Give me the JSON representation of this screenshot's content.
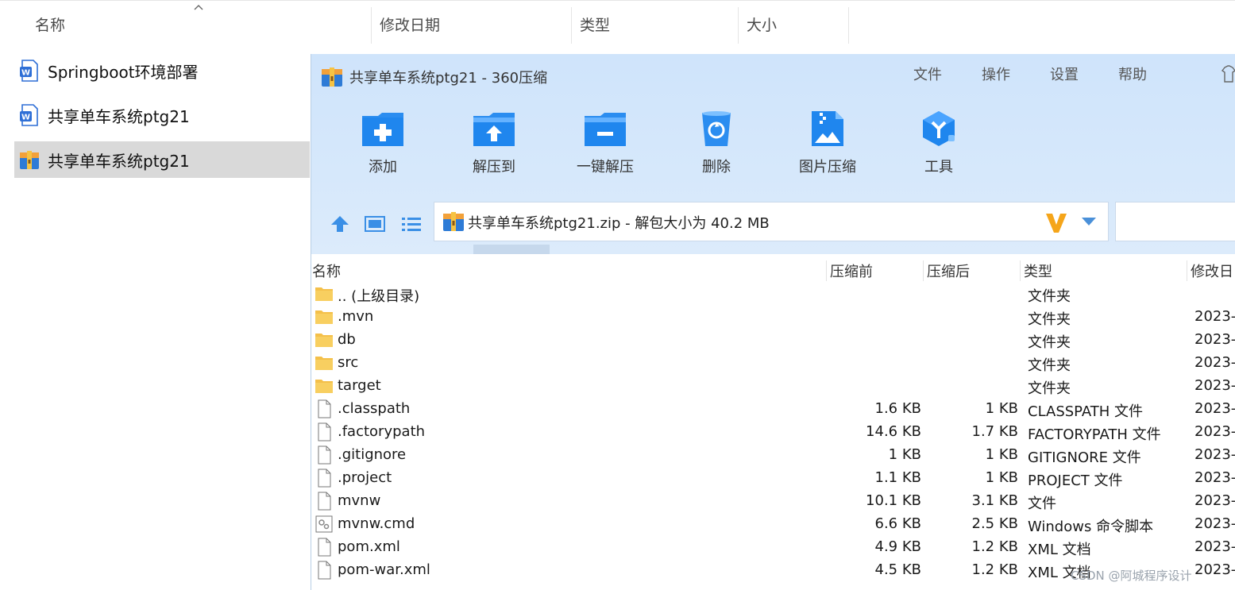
{
  "explorer": {
    "columns": [
      "名称",
      "修改日期",
      "类型",
      "大小"
    ],
    "files": [
      {
        "name": "Springboot环境部署",
        "icon": "wps-doc-icon"
      },
      {
        "name": "共享单车系统ptg21",
        "icon": "wps-doc-icon"
      },
      {
        "name": "共享单车系统ptg21",
        "icon": "archive-icon",
        "selected": true
      }
    ]
  },
  "zip": {
    "title": "共享单车系统ptg21 - 360压缩",
    "menu": [
      "文件",
      "操作",
      "设置",
      "帮助"
    ],
    "toolbar": [
      "添加",
      "解压到",
      "一键解压",
      "删除",
      "图片压缩",
      "工具"
    ],
    "path": "共享单车系统ptg21.zip - 解包大小为 40.2 MB",
    "list_headers": [
      "名称",
      "压缩前",
      "压缩后",
      "类型",
      "修改日"
    ],
    "rows": [
      {
        "name": ".. (上级目录)",
        "before": "",
        "after": "",
        "type": "文件夹",
        "date": "",
        "icon": "folder"
      },
      {
        "name": ".mvn",
        "before": "",
        "after": "",
        "type": "文件夹",
        "date": "2023-",
        "icon": "folder"
      },
      {
        "name": "db",
        "before": "",
        "after": "",
        "type": "文件夹",
        "date": "2023-",
        "icon": "folder"
      },
      {
        "name": "src",
        "before": "",
        "after": "",
        "type": "文件夹",
        "date": "2023-",
        "icon": "folder"
      },
      {
        "name": "target",
        "before": "",
        "after": "",
        "type": "文件夹",
        "date": "2023-",
        "icon": "folder"
      },
      {
        "name": ".classpath",
        "before": "1.6 KB",
        "after": "1 KB",
        "type": "CLASSPATH 文件",
        "date": "2023-",
        "icon": "file"
      },
      {
        "name": ".factorypath",
        "before": "14.6 KB",
        "after": "1.7 KB",
        "type": "FACTORYPATH 文件",
        "date": "2023-",
        "icon": "file"
      },
      {
        "name": ".gitignore",
        "before": "1 KB",
        "after": "1 KB",
        "type": "GITIGNORE 文件",
        "date": "2023-",
        "icon": "file"
      },
      {
        "name": ".project",
        "before": "1.1 KB",
        "after": "1 KB",
        "type": "PROJECT 文件",
        "date": "2023-",
        "icon": "file"
      },
      {
        "name": "mvnw",
        "before": "10.1 KB",
        "after": "3.1 KB",
        "type": "文件",
        "date": "2023-",
        "icon": "file"
      },
      {
        "name": "mvnw.cmd",
        "before": "6.6 KB",
        "after": "2.5 KB",
        "type": "Windows 命令脚本",
        "date": "2023-",
        "icon": "cmd"
      },
      {
        "name": "pom.xml",
        "before": "4.9 KB",
        "after": "1.2 KB",
        "type": "XML 文档",
        "date": "2023-",
        "icon": "file"
      },
      {
        "name": "pom-war.xml",
        "before": "4.5 KB",
        "after": "1.2 KB",
        "type": "XML 文档",
        "date": "2023-",
        "icon": "file"
      }
    ]
  },
  "watermark": "CSDN @阿城程序设计"
}
